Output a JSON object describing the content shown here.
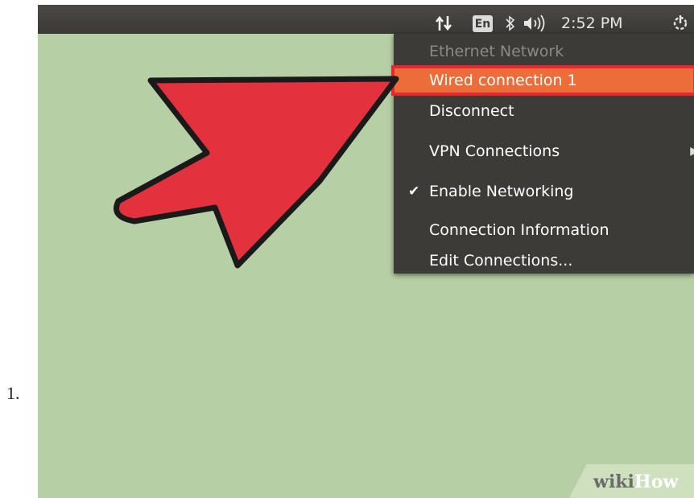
{
  "step": {
    "number": "1."
  },
  "panel": {
    "language": "En",
    "clock": "2:52 PM",
    "icons": [
      "network-updown-icon",
      "bluetooth-icon",
      "volume-icon",
      "gear-power-icon"
    ]
  },
  "menu": {
    "section_title": "Ethernet Network",
    "items": [
      {
        "label": "Wired connection 1"
      },
      {
        "label": "Disconnect"
      },
      {
        "label": "VPN Connections"
      },
      {
        "label": "Enable Networking"
      },
      {
        "label": "Connection Information"
      },
      {
        "label": "Edit Connections..."
      }
    ],
    "highlight_color": "#ec6d3a"
  },
  "annotation": {
    "arrow_color": "#e3323d"
  },
  "watermark": {
    "wiki": "wiki",
    "how": "How"
  },
  "colors": {
    "desktop": "#b7cfa4",
    "panel": "#3c3b37"
  }
}
